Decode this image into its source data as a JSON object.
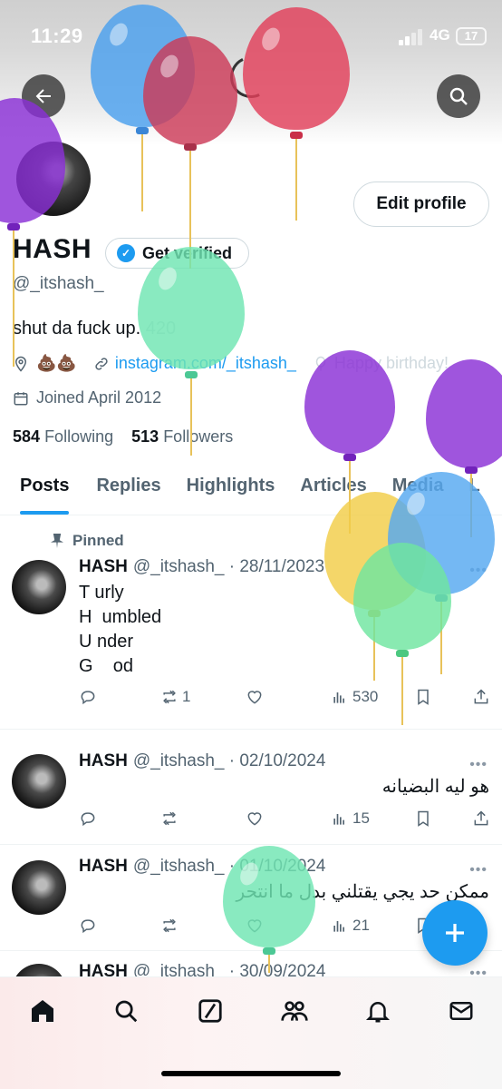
{
  "status": {
    "time": "11:29",
    "network": "4G",
    "battery": "17"
  },
  "header": {
    "back_icon": "arrow-left-icon",
    "search_icon": "search-icon"
  },
  "profile": {
    "name": "HASH",
    "verify_label": "Get verified",
    "handle": "@_itshash_",
    "bio_text": "shut da fuck up.",
    "bio_number": "420",
    "location": "💩💩",
    "link": "instagram.com/_itshash_",
    "birthday": "Happy birthday!",
    "joined": "Joined April 2012",
    "following_count": "584",
    "following_label": "Following",
    "followers_count": "513",
    "followers_label": "Followers",
    "edit_label": "Edit profile"
  },
  "tabs": [
    "Posts",
    "Replies",
    "Highlights",
    "Articles",
    "Media",
    "L"
  ],
  "pinned_label": "Pinned",
  "posts": [
    {
      "name": "HASH",
      "meta": "@_itshash_ · 28/11/2023",
      "text": "T urly\nH  umbled\nU nder\nG    od",
      "retweets": "1",
      "views": "530"
    },
    {
      "name": "HASH",
      "meta": "@_itshash_ · 02/10/2024",
      "text": "هو ليه البضيانه",
      "views": "15"
    },
    {
      "name": "HASH",
      "meta": "@_itshash_ · 01/10/2024",
      "text": "ممكن حد يجي يقتلني بدل ما انتحر",
      "views": "21"
    },
    {
      "name": "HASH",
      "meta": "@_itshash_ · 30/09/2024"
    }
  ],
  "colors": {
    "accent": "#1d9bf0",
    "text": "#0f1419",
    "muted": "#536471"
  }
}
